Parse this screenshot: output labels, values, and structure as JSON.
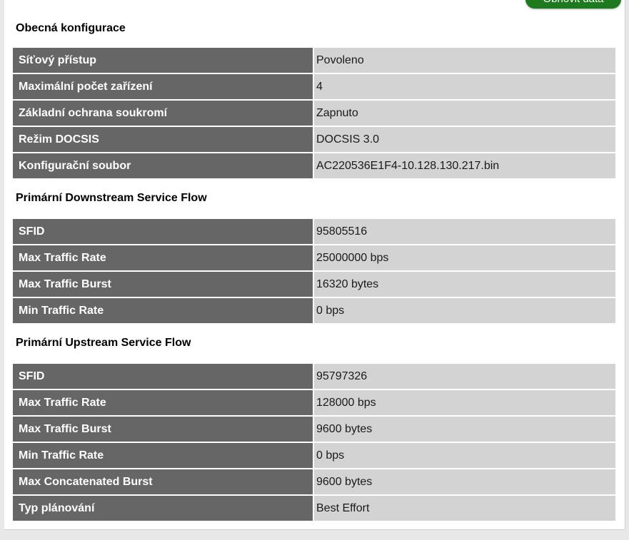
{
  "toolbar": {
    "refresh_label": "Obnovit data"
  },
  "sections": {
    "general": {
      "title": "Obecná konfigurace",
      "rows": [
        {
          "label": "Síťový přístup",
          "value": "Povoleno"
        },
        {
          "label": "Maximální počet zařízení",
          "value": "4"
        },
        {
          "label": "Základní ochrana soukromí",
          "value": "Zapnuto"
        },
        {
          "label": "Režim DOCSIS",
          "value": "DOCSIS 3.0"
        },
        {
          "label": "Konfigurační soubor",
          "value": "AC220536E1F4-10.128.130.217.bin"
        }
      ]
    },
    "downstream": {
      "title": "Primární Downstream Service Flow",
      "rows": [
        {
          "label": "SFID",
          "value": "95805516"
        },
        {
          "label": "Max Traffic Rate",
          "value": "25000000 bps"
        },
        {
          "label": "Max Traffic Burst",
          "value": "16320 bytes"
        },
        {
          "label": "Min Traffic Rate",
          "value": "0 bps"
        }
      ]
    },
    "upstream": {
      "title": "Primární Upstream Service Flow",
      "rows": [
        {
          "label": "SFID",
          "value": "95797326"
        },
        {
          "label": "Max Traffic Rate",
          "value": "128000 bps"
        },
        {
          "label": "Max Traffic Burst",
          "value": "9600 bytes"
        },
        {
          "label": "Min Traffic Rate",
          "value": "0 bps"
        },
        {
          "label": "Max Concatenated Burst",
          "value": "9600 bytes"
        },
        {
          "label": "Typ plánování",
          "value": "Best Effort"
        }
      ]
    }
  }
}
